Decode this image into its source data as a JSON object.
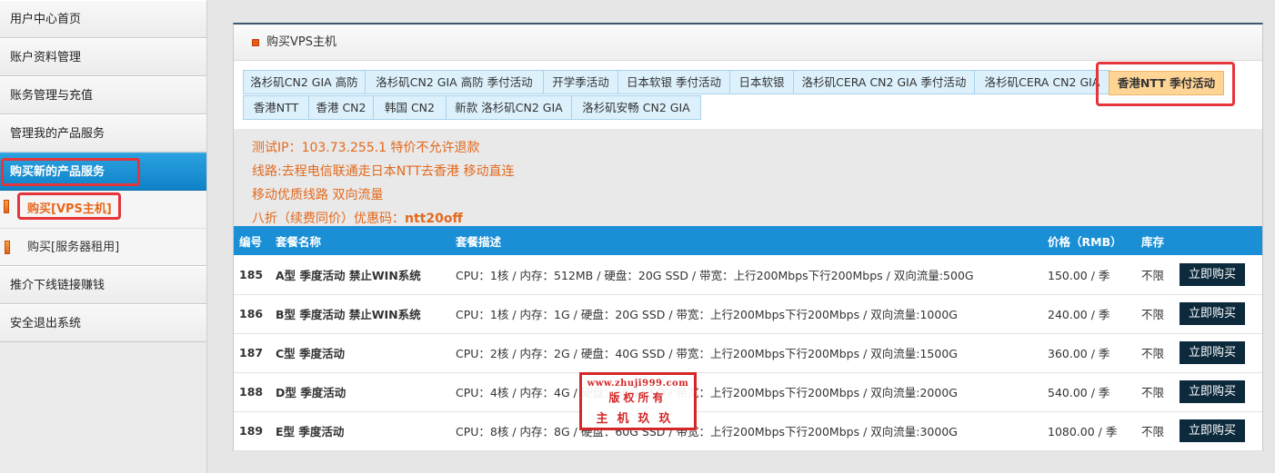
{
  "sidebar": {
    "items": [
      {
        "label": "用户中心首页"
      },
      {
        "label": "账户资料管理"
      },
      {
        "label": "账务管理与充值"
      },
      {
        "label": "管理我的产品服务"
      },
      {
        "label": "购买新的产品服务"
      },
      {
        "label": "推介下线链接赚钱"
      },
      {
        "label": "安全退出系统"
      }
    ],
    "sub_items": [
      {
        "label": "购买[VPS主机]"
      },
      {
        "label": "购买[服务器租用]"
      }
    ]
  },
  "panel": {
    "title": "购买VPS主机",
    "tabs": [
      {
        "label": "洛杉矶CN2 GIA 高防"
      },
      {
        "label": "洛杉矶CN2 GIA 高防 季付活动"
      },
      {
        "label": "开学季活动"
      },
      {
        "label": "日本软银 季付活动"
      },
      {
        "label": "日本软银"
      },
      {
        "label": "洛杉矶CERA CN2 GIA 季付活动"
      },
      {
        "label": "洛杉矶CERA CN2 GIA"
      },
      {
        "label": "香港NTT 季付活动"
      },
      {
        "label": "香港NTT"
      },
      {
        "label": "香港 CN2"
      },
      {
        "label": "韩国 CN2"
      },
      {
        "label": "新款 洛杉矶CN2 GIA"
      },
      {
        "label": "洛杉矶安畅 CN2 GIA"
      }
    ],
    "info": {
      "line1": "测试IP：103.73.255.1 特价不允许退款",
      "line2": "线路:去程电信联通走日本NTT去香港 移动直连",
      "line3": "移动优质线路 双向流量",
      "line4_prefix": "八折（续费同价）优惠码：",
      "line4_code": "ntt20off"
    },
    "table": {
      "headers": {
        "num": "编号",
        "name": "套餐名称",
        "desc": "套餐描述",
        "price": "价格（RMB）",
        "stock": "库存"
      },
      "rows": [
        {
          "num": "185",
          "name": "A型 季度活动 禁止WIN系统",
          "desc": "CPU：1核 / 内存：512MB / 硬盘：20G SSD / 带宽：上行200Mbps下行200Mbps / 双向流量:500G",
          "price": "150.00 / 季",
          "stock": "不限",
          "button": "立即购买"
        },
        {
          "num": "186",
          "name": "B型 季度活动 禁止WIN系统",
          "desc": "CPU：1核 / 内存：1G / 硬盘：20G SSD / 带宽：上行200Mbps下行200Mbps / 双向流量:1000G",
          "price": "240.00 / 季",
          "stock": "不限",
          "button": "立即购买"
        },
        {
          "num": "187",
          "name": "C型 季度活动",
          "desc": "CPU：2核 / 内存：2G / 硬盘：40G SSD / 带宽：上行200Mbps下行200Mbps / 双向流量:1500G",
          "price": "360.00 / 季",
          "stock": "不限",
          "button": "立即购买"
        },
        {
          "num": "188",
          "name": "D型 季度活动",
          "desc": "CPU：4核 / 内存：4G / 硬盘：60G SSD / 带宽：上行200Mbps下行200Mbps / 双向流量:2000G",
          "price": "540.00 / 季",
          "stock": "不限",
          "button": "立即购买"
        },
        {
          "num": "189",
          "name": "E型 季度活动",
          "desc": "CPU：8核 / 内存：8G / 硬盘：60G SSD / 带宽：上行200Mbps下行200Mbps / 双向流量:3000G",
          "price": "1080.00 / 季",
          "stock": "不限",
          "button": "立即购买"
        }
      ]
    }
  },
  "watermark": {
    "url": "www.zhuji999.com",
    "line2": "版权所有",
    "line3": "主机玖玖"
  },
  "colors": {
    "active_nav": "#1a8fd6",
    "highlight": "#e5343a",
    "info_text": "#e3691d",
    "active_tab": "#ffd596",
    "buy_button": "#0c2a3c"
  }
}
